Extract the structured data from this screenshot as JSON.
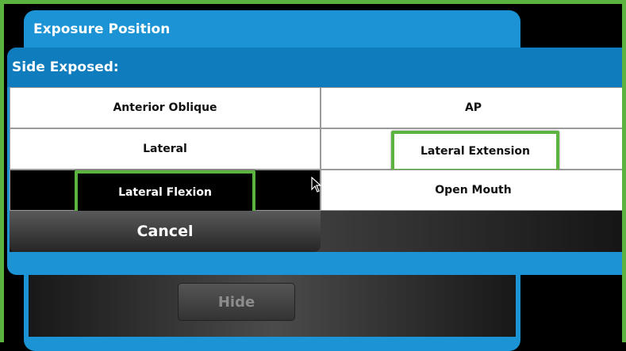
{
  "back_panel": {
    "title": "Exposure Position",
    "hide_label": "Hide"
  },
  "dialog": {
    "title": "Side Exposed:",
    "options": [
      {
        "label": "Anterior Oblique",
        "selected": false,
        "highlighted": false
      },
      {
        "label": "AP",
        "selected": false,
        "highlighted": false
      },
      {
        "label": "Lateral",
        "selected": false,
        "highlighted": false
      },
      {
        "label": "Lateral Extension",
        "selected": false,
        "highlighted": true
      },
      {
        "label": "Lateral Flexion",
        "selected": true,
        "highlighted": true
      },
      {
        "label": "Open Mouth",
        "selected": false,
        "highlighted": false
      }
    ],
    "cancel_label": "Cancel"
  },
  "colors": {
    "accent_blue": "#1b93d4",
    "header_blue": "#0f7cbd",
    "highlight_green": "#5cb340"
  },
  "icons": {
    "cursor": "mouse-pointer-icon"
  }
}
